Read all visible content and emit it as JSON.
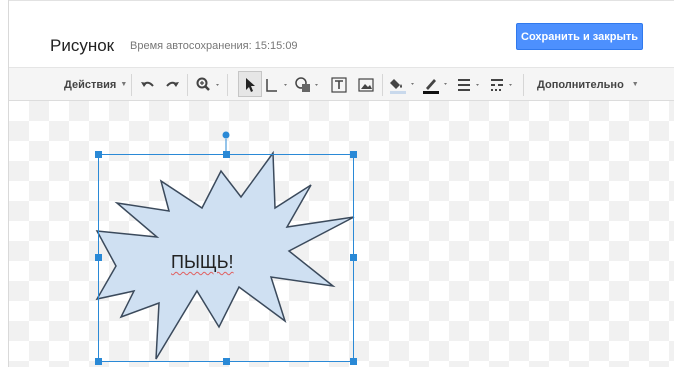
{
  "header": {
    "title": "Рисунок",
    "autosave": "Время автосохранения: 15:15:09",
    "save_button": "Сохранить и закрыть"
  },
  "toolbar": {
    "actions_label": "Действия",
    "more_label": "Дополнительно",
    "icons": [
      "undo-icon",
      "redo-icon",
      "zoom-icon",
      "select-icon",
      "line-icon",
      "shape-icon",
      "textbox-icon",
      "image-icon",
      "fill-color-icon",
      "line-color-icon",
      "line-weight-icon",
      "line-dash-icon"
    ]
  },
  "canvas": {
    "shape_type": "explosion",
    "shape_fill": "#cfe0f2",
    "shape_stroke": "#3b4a5c",
    "selection_color": "#2a89d6",
    "shape_text": "ПЫЩЬ!"
  }
}
